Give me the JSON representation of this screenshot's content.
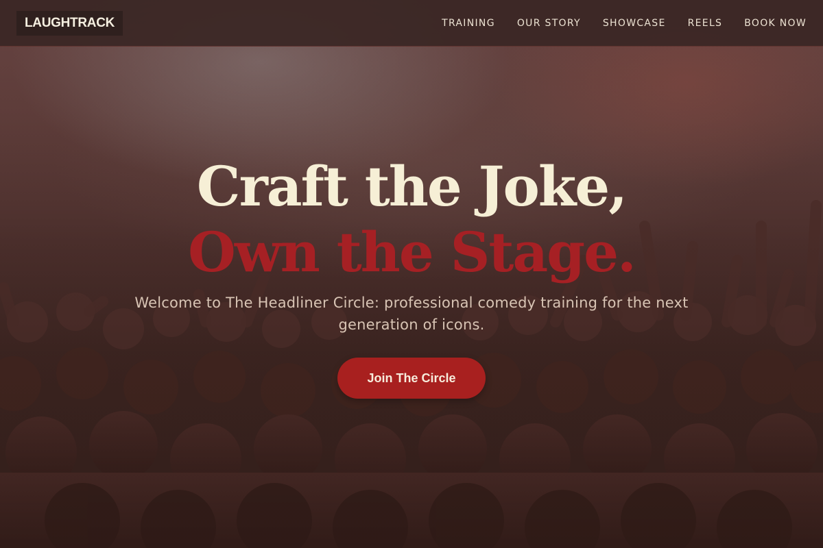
{
  "brand": {
    "logo_text": "LAUGHTRACK"
  },
  "nav": {
    "items": [
      {
        "label": "TRAINING"
      },
      {
        "label": "OUR STORY"
      },
      {
        "label": "SHOWCASE"
      },
      {
        "label": "REELS"
      },
      {
        "label": "BOOK NOW"
      }
    ]
  },
  "hero": {
    "headline_line1": "Craft the Joke,",
    "headline_line2": "Own the Stage.",
    "subtitle": "Welcome to The Headliner Circle: professional comedy training for the next generation of icons.",
    "cta_label": "Join The Circle",
    "background": "concert crowd photo with raised hands"
  },
  "colors": {
    "accent_red": "#a8201f",
    "headline_cream": "#f6efd6",
    "headline_red": "#a62024",
    "navbar_bg": "#3a2624"
  }
}
